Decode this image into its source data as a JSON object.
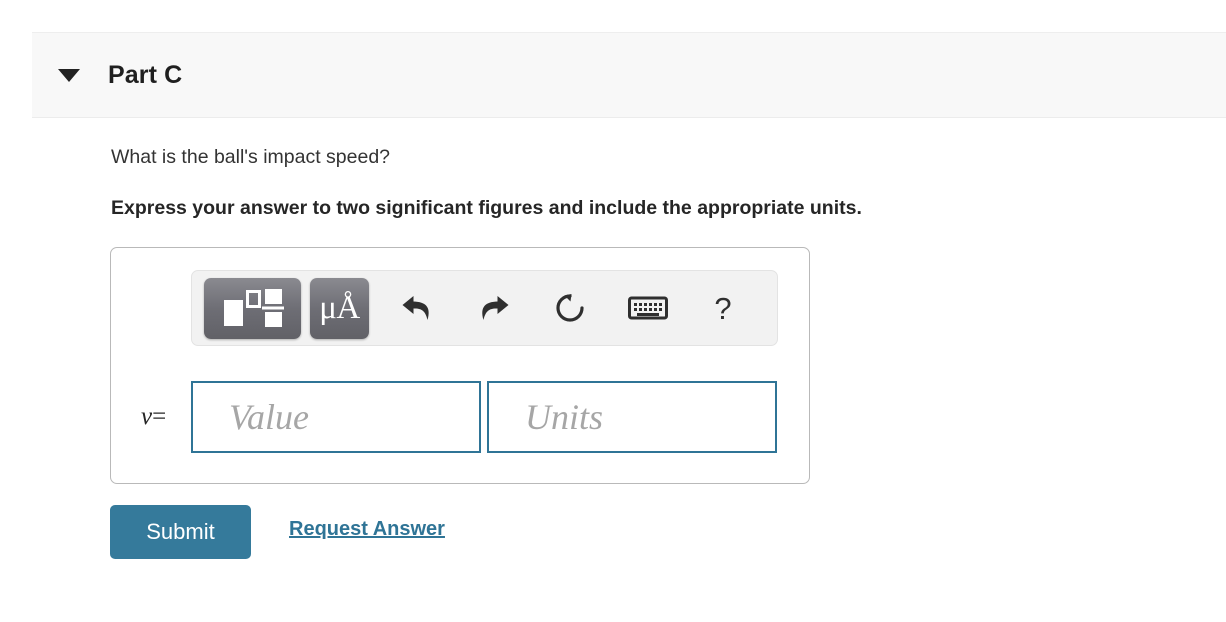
{
  "header": {
    "caret_icon": "caret-down-icon",
    "title": "Part C"
  },
  "question": {
    "prompt": "What is the ball's impact speed?",
    "instruction": "Express your answer to two significant figures and include the appropriate units."
  },
  "toolbar": {
    "buttons": [
      {
        "name": "math-template-button",
        "icon": "math-template-icon",
        "label": ""
      },
      {
        "name": "units-button",
        "icon": "micro-angstrom-icon",
        "label": "μÅ"
      },
      {
        "name": "undo-button",
        "icon": "undo-arrow-icon",
        "label": ""
      },
      {
        "name": "redo-button",
        "icon": "redo-arrow-icon",
        "label": ""
      },
      {
        "name": "reset-button",
        "icon": "reset-circular-arrow-icon",
        "label": ""
      },
      {
        "name": "keyboard-button",
        "icon": "keyboard-icon",
        "label": ""
      },
      {
        "name": "help-button",
        "icon": "question-mark-icon",
        "label": "?"
      }
    ]
  },
  "answer": {
    "variable_label": "v",
    "equals_sign": "=",
    "value_placeholder": "Value",
    "value": "",
    "units_placeholder": "Units",
    "units": ""
  },
  "actions": {
    "submit_label": "Submit",
    "request_answer_label": "Request Answer"
  },
  "colors": {
    "accent_blue": "#357a9b",
    "input_border": "#2f7496",
    "header_bg": "#f8f8f8",
    "toolbar_bg": "#f2f2f2",
    "placeholder_gray": "#a6a6a6"
  }
}
